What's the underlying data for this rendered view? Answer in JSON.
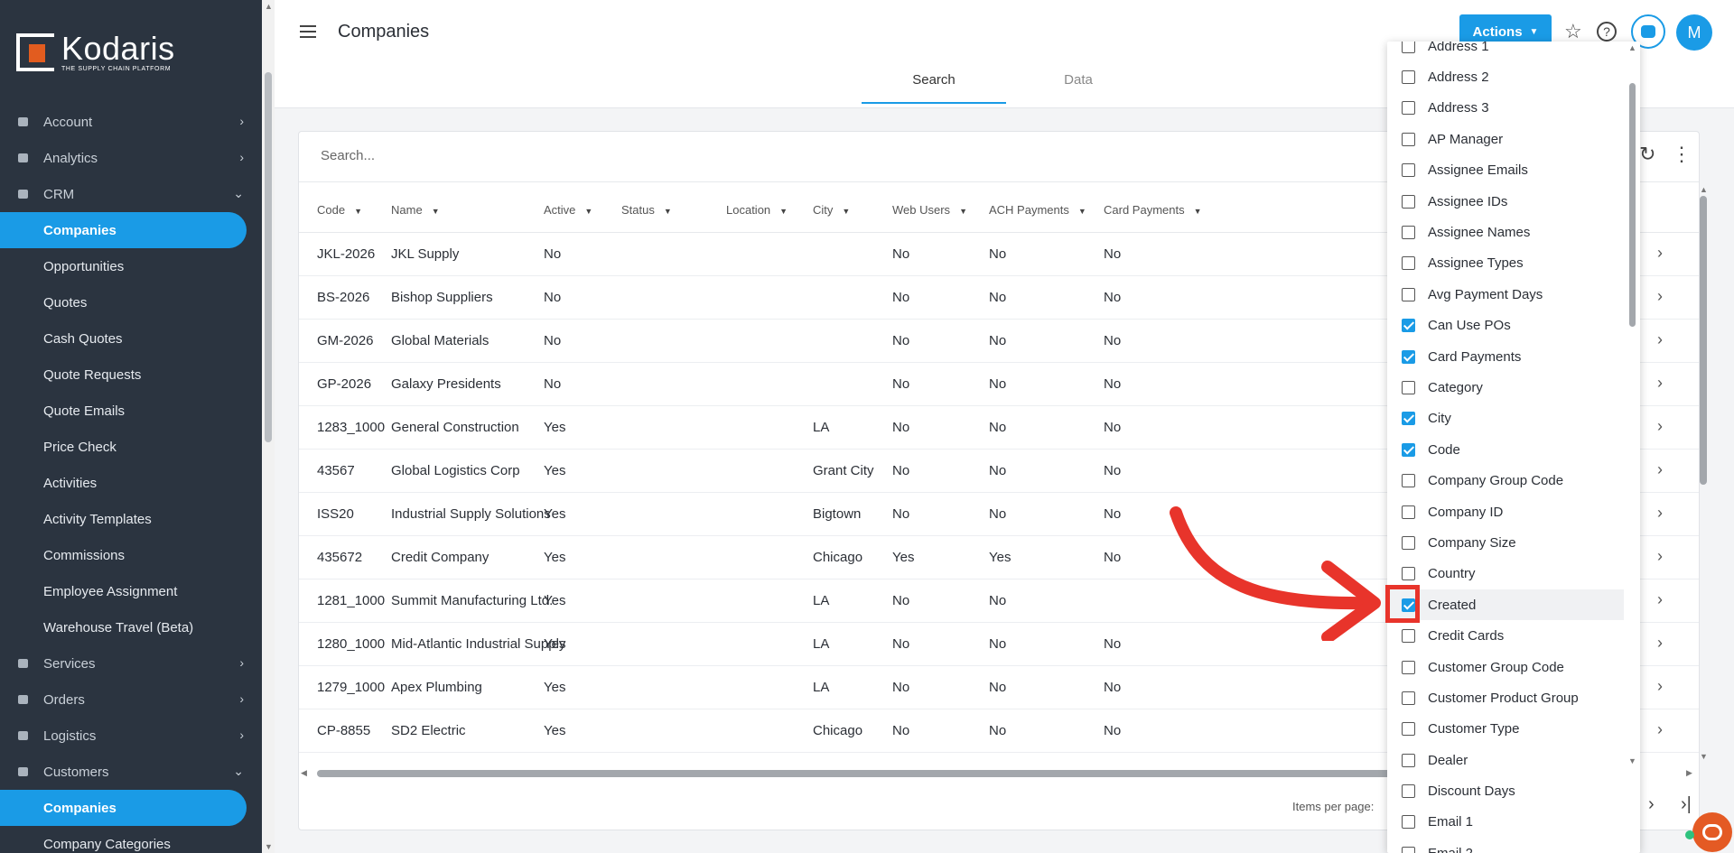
{
  "brand": {
    "name": "Kodaris",
    "tagline": "THE SUPPLY CHAIN PLATFORM",
    "accent": "#1a9be6",
    "logo_color": "#e25c1f"
  },
  "sidebar": {
    "items": [
      {
        "type": "section",
        "label": "Account",
        "icon": "user-icon",
        "chevron": "›"
      },
      {
        "type": "section",
        "label": "Analytics",
        "icon": "chart-icon",
        "chevron": "›"
      },
      {
        "type": "section",
        "label": "CRM",
        "icon": "briefcase-icon",
        "chevron": "⌄"
      },
      {
        "type": "sub",
        "label": "Companies",
        "active": true
      },
      {
        "type": "sub",
        "label": "Opportunities"
      },
      {
        "type": "sub",
        "label": "Quotes"
      },
      {
        "type": "sub",
        "label": "Cash Quotes"
      },
      {
        "type": "sub",
        "label": "Quote Requests"
      },
      {
        "type": "sub",
        "label": "Quote Emails"
      },
      {
        "type": "sub",
        "label": "Price Check"
      },
      {
        "type": "sub",
        "label": "Activities"
      },
      {
        "type": "sub",
        "label": "Activity Templates"
      },
      {
        "type": "sub",
        "label": "Commissions"
      },
      {
        "type": "sub",
        "label": "Employee Assignment"
      },
      {
        "type": "sub",
        "label": "Warehouse Travel (Beta)"
      },
      {
        "type": "section",
        "label": "Services",
        "icon": "gears-icon",
        "chevron": "›"
      },
      {
        "type": "section",
        "label": "Orders",
        "icon": "truck-icon",
        "chevron": "›"
      },
      {
        "type": "section",
        "label": "Logistics",
        "icon": "delivery-icon",
        "chevron": "›"
      },
      {
        "type": "section",
        "label": "Customers",
        "icon": "people-icon",
        "chevron": "⌄"
      },
      {
        "type": "sub",
        "label": "Companies",
        "active": true
      },
      {
        "type": "sub",
        "label": "Company Categories"
      }
    ]
  },
  "header": {
    "title": "Companies",
    "actions_label": "Actions",
    "avatar_initial": "M",
    "tabs": [
      {
        "label": "Search",
        "active": true
      },
      {
        "label": "Data",
        "active": false
      }
    ]
  },
  "search": {
    "placeholder": "Search..."
  },
  "table": {
    "columns": [
      "Code",
      "Name",
      "Active",
      "Status",
      "Location",
      "City",
      "Web Users",
      "ACH Payments",
      "Card Payments"
    ],
    "rows": [
      [
        "JKL-2026",
        "JKL Supply",
        "No",
        "",
        "",
        "",
        "No",
        "No",
        "No"
      ],
      [
        "BS-2026",
        "Bishop Suppliers",
        "No",
        "",
        "",
        "",
        "No",
        "No",
        "No"
      ],
      [
        "GM-2026",
        "Global Materials",
        "No",
        "",
        "",
        "",
        "No",
        "No",
        "No"
      ],
      [
        "GP-2026",
        "Galaxy Presidents",
        "No",
        "",
        "",
        "",
        "No",
        "No",
        "No"
      ],
      [
        "1283_1000",
        "General Construction",
        "Yes",
        "",
        "",
        "LA",
        "No",
        "No",
        "No"
      ],
      [
        "43567",
        "Global Logistics Corp",
        "Yes",
        "",
        "",
        "Grant City",
        "No",
        "No",
        "No"
      ],
      [
        "ISS20",
        "Industrial Supply Solutions",
        "Yes",
        "",
        "",
        "Bigtown",
        "No",
        "No",
        "No"
      ],
      [
        "435672",
        "Credit Company",
        "Yes",
        "",
        "",
        "Chicago",
        "Yes",
        "Yes",
        "No"
      ],
      [
        "1281_1000",
        "Summit Manufacturing Ltd.",
        "Yes",
        "",
        "",
        "LA",
        "No",
        "No",
        ""
      ],
      [
        "1280_1000",
        "Mid-Atlantic Industrial Supply",
        "Yes",
        "",
        "",
        "LA",
        "No",
        "No",
        "No"
      ],
      [
        "1279_1000",
        "Apex Plumbing",
        "Yes",
        "",
        "",
        "LA",
        "No",
        "No",
        "No"
      ],
      [
        "CP-8855",
        "SD2 Electric",
        "Yes",
        "",
        "",
        "Chicago",
        "No",
        "No",
        "No"
      ]
    ]
  },
  "pagination": {
    "items_per_page_label": "Items per page:"
  },
  "column_chooser": {
    "options": [
      {
        "label": "Address 1",
        "checked": false
      },
      {
        "label": "Address 2",
        "checked": false
      },
      {
        "label": "Address 3",
        "checked": false
      },
      {
        "label": "AP Manager",
        "checked": false
      },
      {
        "label": "Assignee Emails",
        "checked": false
      },
      {
        "label": "Assignee IDs",
        "checked": false
      },
      {
        "label": "Assignee Names",
        "checked": false
      },
      {
        "label": "Assignee Types",
        "checked": false
      },
      {
        "label": "Avg Payment Days",
        "checked": false
      },
      {
        "label": "Can Use POs",
        "checked": true
      },
      {
        "label": "Card Payments",
        "checked": true
      },
      {
        "label": "Category",
        "checked": false
      },
      {
        "label": "City",
        "checked": true
      },
      {
        "label": "Code",
        "checked": true
      },
      {
        "label": "Company Group Code",
        "checked": false
      },
      {
        "label": "Company ID",
        "checked": false
      },
      {
        "label": "Company Size",
        "checked": false
      },
      {
        "label": "Country",
        "checked": false
      },
      {
        "label": "Created",
        "checked": true,
        "highlighted": true
      },
      {
        "label": "Credit Cards",
        "checked": false
      },
      {
        "label": "Customer Group Code",
        "checked": false
      },
      {
        "label": "Customer Product Group",
        "checked": false
      },
      {
        "label": "Customer Type",
        "checked": false
      },
      {
        "label": "Dealer",
        "checked": false
      },
      {
        "label": "Discount Days",
        "checked": false
      },
      {
        "label": "Email 1",
        "checked": false
      },
      {
        "label": "Email 2",
        "checked": false
      }
    ]
  },
  "annotation": {
    "color": "#e8342b"
  }
}
